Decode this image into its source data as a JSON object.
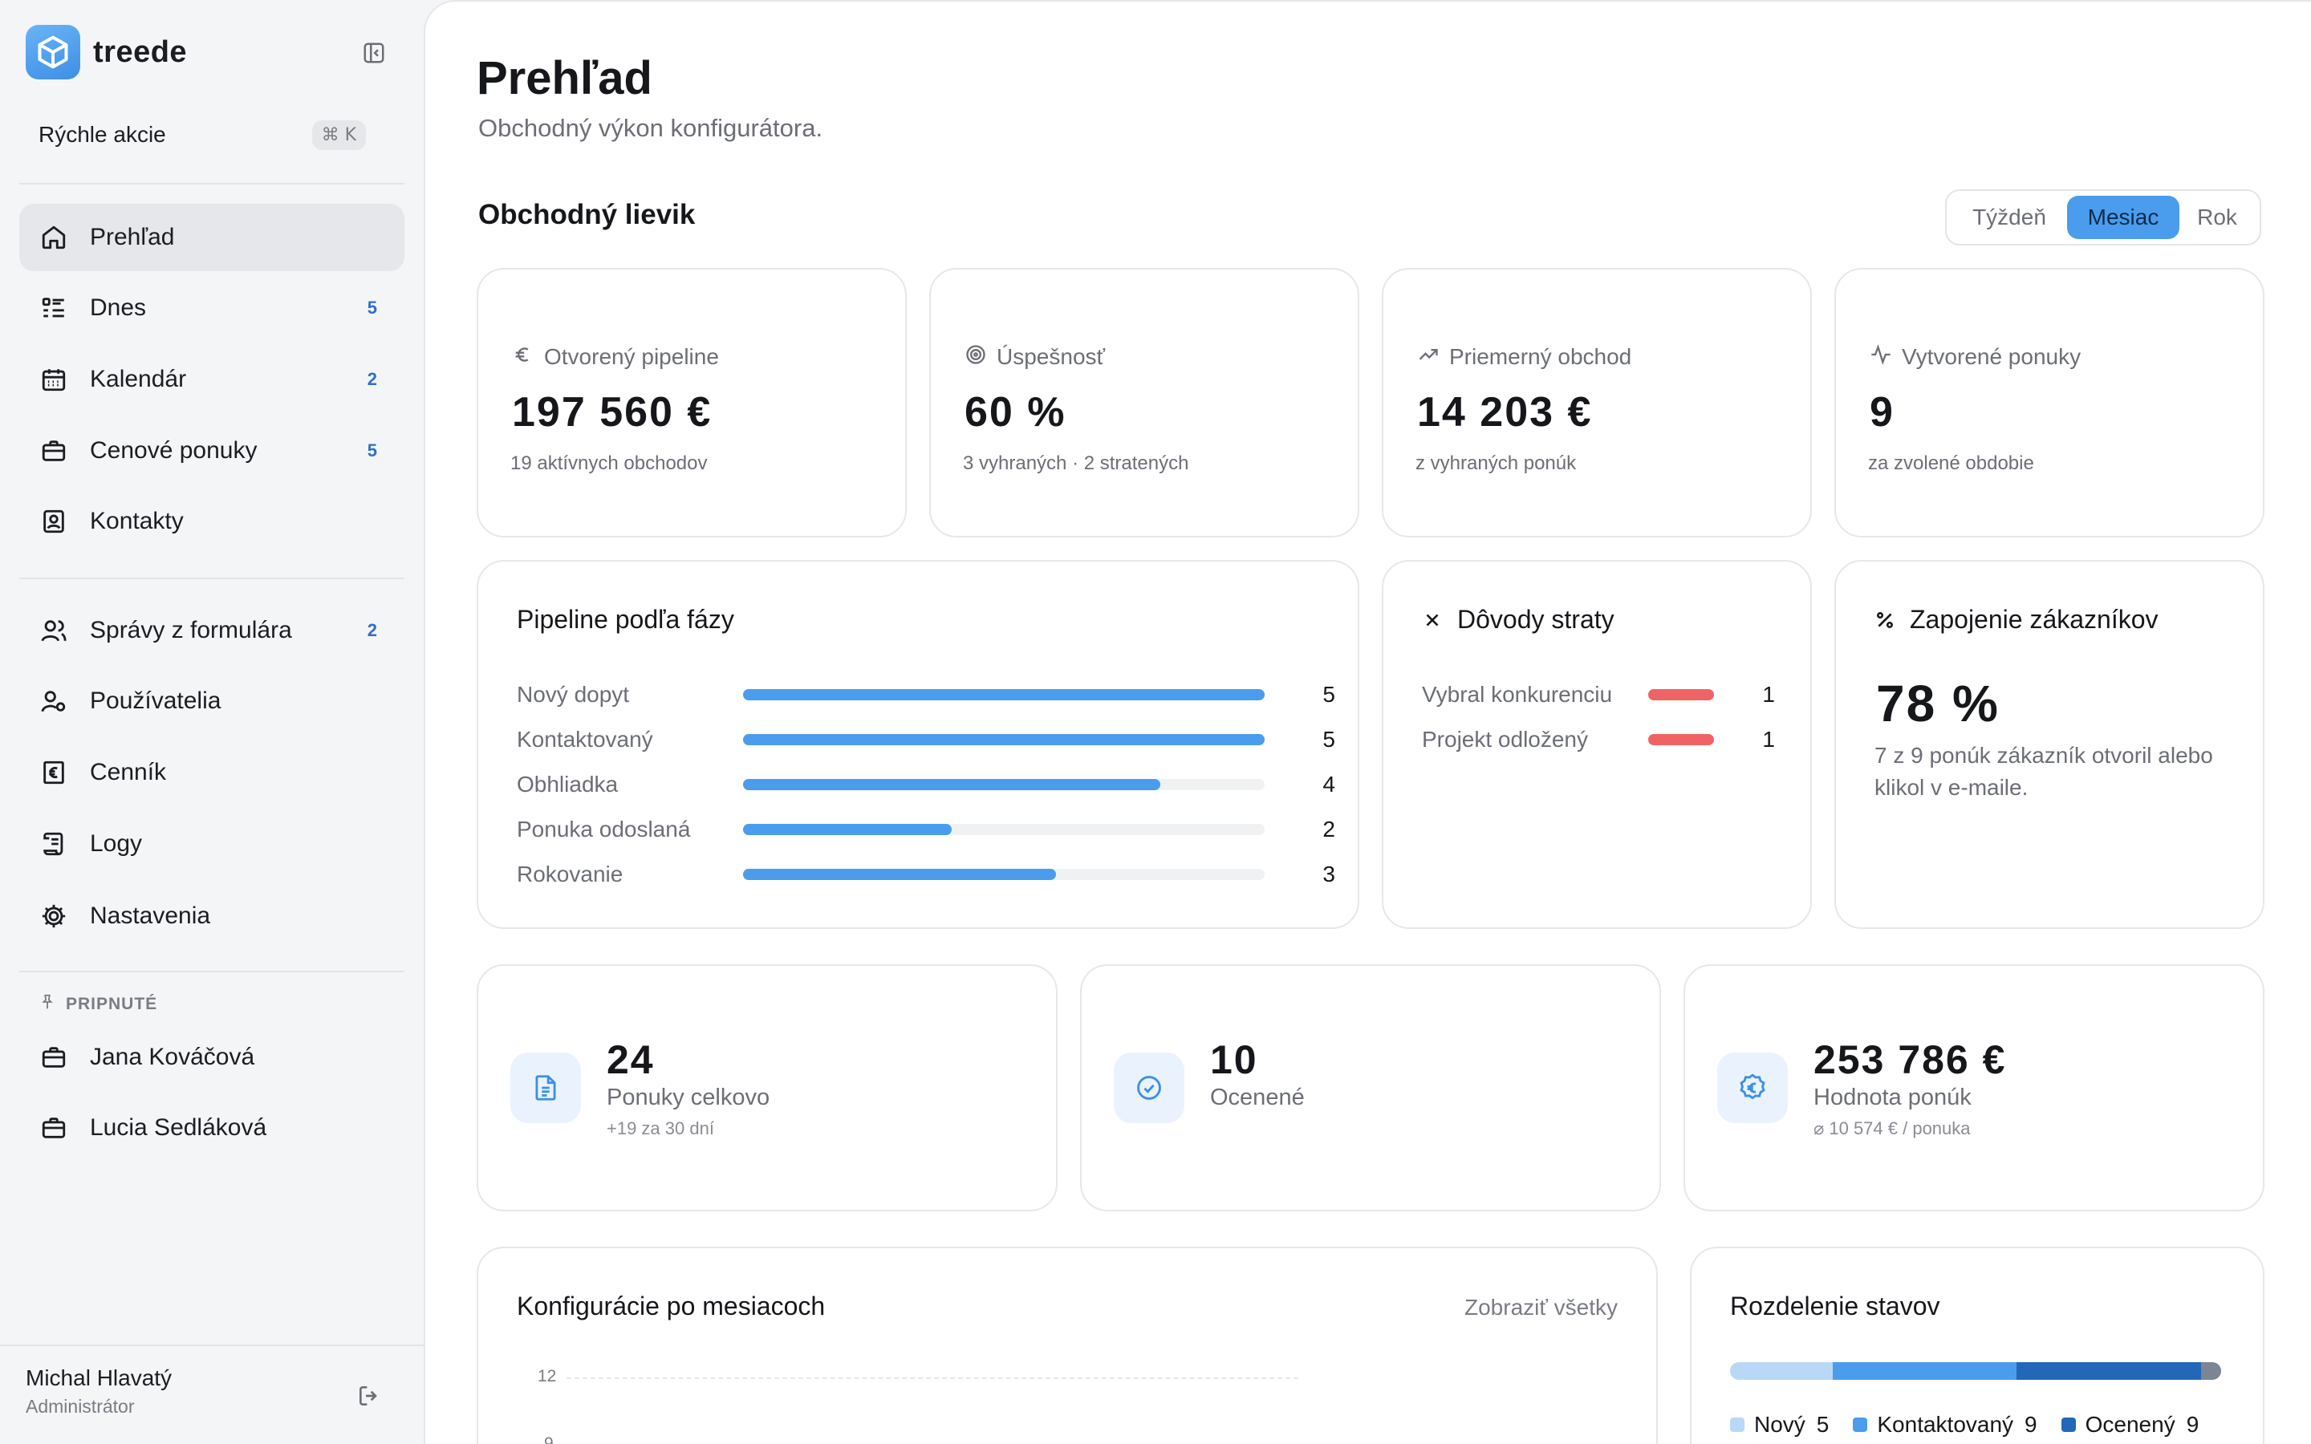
{
  "brand": {
    "name": "treede"
  },
  "quick_actions": {
    "label": "Rýchle akcie",
    "shortcut": "⌘ K"
  },
  "nav_primary": [
    {
      "label": "Prehľad",
      "icon": "home-icon",
      "active": true,
      "badge": ""
    },
    {
      "label": "Dnes",
      "icon": "list-icon",
      "badge": "5"
    },
    {
      "label": "Kalendár",
      "icon": "calendar-icon",
      "badge": "2"
    },
    {
      "label": "Cenové ponuky",
      "icon": "briefcase-icon",
      "badge": "5"
    },
    {
      "label": "Kontakty",
      "icon": "contact-icon",
      "badge": ""
    }
  ],
  "nav_secondary": [
    {
      "label": "Správy z formulára",
      "icon": "users-icon",
      "badge": "2"
    },
    {
      "label": "Používatelia",
      "icon": "user-settings-icon",
      "badge": ""
    },
    {
      "label": "Cenník",
      "icon": "euro-doc-icon",
      "badge": ""
    },
    {
      "label": "Logy",
      "icon": "scroll-icon",
      "badge": ""
    },
    {
      "label": "Nastavenia",
      "icon": "gear-icon",
      "badge": ""
    }
  ],
  "pinned": {
    "title": "PRIPNUTÉ",
    "items": [
      {
        "label": "Jana Kováčová",
        "icon": "briefcase-icon"
      },
      {
        "label": "Lucia Sedláková",
        "icon": "briefcase-icon"
      }
    ]
  },
  "user": {
    "name": "Michal Hlavatý",
    "role": "Administrátor"
  },
  "page": {
    "title": "Prehľad",
    "subtitle": "Obchodný výkon konfigurátora."
  },
  "funnel": {
    "title": "Obchodný lievik",
    "periods": [
      "Týždeň",
      "Mesiac",
      "Rok"
    ],
    "selected_period": "Mesiac"
  },
  "kpis": [
    {
      "icon": "euro-icon",
      "label": "Otvorený pipeline",
      "value": "197 560 €",
      "note": "19 aktívnych obchodov"
    },
    {
      "icon": "target-icon",
      "label": "Úspešnosť",
      "value": "60 %",
      "note": "3 vyhraných · 2 stratených"
    },
    {
      "icon": "trend-up-icon",
      "label": "Priemerný obchod",
      "value": "14 203 €",
      "note": "z vyhraných ponúk"
    },
    {
      "icon": "activity-icon",
      "label": "Vytvorené ponuky",
      "value": "9",
      "note": "za zvolené obdobie"
    }
  ],
  "pipeline": {
    "title": "Pipeline podľa fázy",
    "max": 5,
    "rows": [
      {
        "label": "Nový dopyt",
        "value": 5
      },
      {
        "label": "Kontaktovaný",
        "value": 5
      },
      {
        "label": "Obhliadka",
        "value": 4
      },
      {
        "label": "Ponuka odoslaná",
        "value": 2
      },
      {
        "label": "Rokovanie",
        "value": 3
      }
    ]
  },
  "loss": {
    "title": "Dôvody straty",
    "rows": [
      {
        "label": "Vybral konkurenciu",
        "value": 1
      },
      {
        "label": "Projekt odložený",
        "value": 1
      }
    ]
  },
  "engagement": {
    "title": "Zapojenie zákazníkov",
    "value": "78 %",
    "note": "7 z 9 ponúk zákazník otvoril alebo klikol v e-maile."
  },
  "stats": [
    {
      "icon": "document-icon",
      "value": "24",
      "label": "Ponuky celkovo",
      "note": "+19 za 30 dní"
    },
    {
      "icon": "check-circle-icon",
      "value": "10",
      "label": "Ocenené",
      "note": ""
    },
    {
      "icon": "euro-badge-icon",
      "value": "253 786 €",
      "label": "Hodnota ponúk",
      "note": "⌀ 10 574 € / ponuka"
    }
  ],
  "monthly": {
    "title": "Konfigurácie po mesiacoch",
    "link": "Zobraziť všetky",
    "y_ticks": [
      "12",
      "9"
    ]
  },
  "status_split": {
    "title": "Rozdelenie stavov",
    "segments": [
      {
        "label": "Nový",
        "value": 5,
        "color": "#b9d8f7"
      },
      {
        "label": "Kontaktovaný",
        "value": 9,
        "color": "#4a9ded"
      },
      {
        "label": "Ocenený",
        "value": 9,
        "color": "#2368b8"
      },
      {
        "label": "",
        "value": 1,
        "color": "#7b8593"
      }
    ]
  },
  "colors": {
    "accent": "#4a9ded",
    "loss": "#f06364",
    "badge": "#2f6fc9"
  }
}
